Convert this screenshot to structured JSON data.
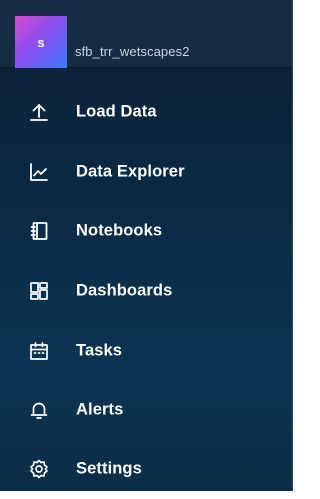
{
  "org": {
    "avatar_letter": "s",
    "name": "sfb_trr_wetscapes2"
  },
  "nav": {
    "items": [
      {
        "label": "Load Data",
        "icon": "upload-icon"
      },
      {
        "label": "Data Explorer",
        "icon": "graph-icon"
      },
      {
        "label": "Notebooks",
        "icon": "notebook-icon"
      },
      {
        "label": "Dashboards",
        "icon": "dashboards-icon"
      },
      {
        "label": "Tasks",
        "icon": "calendar-icon"
      },
      {
        "label": "Alerts",
        "icon": "bell-icon"
      },
      {
        "label": "Settings",
        "icon": "gear-icon"
      }
    ]
  },
  "colors": {
    "nav_background": "#0b2a44",
    "text": "#ffffff",
    "avatar_gradient_start": "#d64bd1",
    "avatar_gradient_end": "#3c7bff"
  }
}
